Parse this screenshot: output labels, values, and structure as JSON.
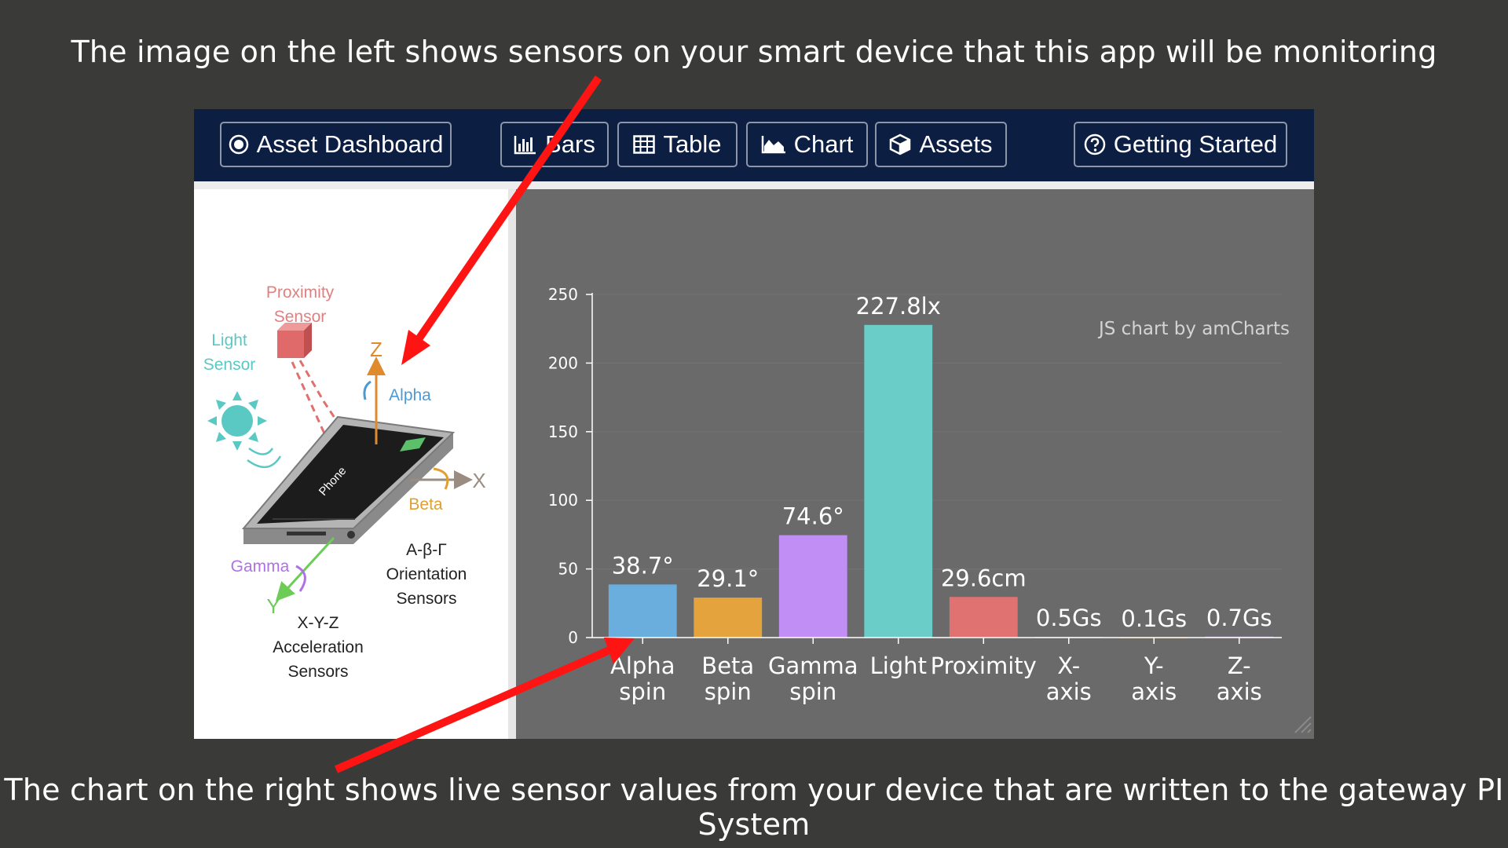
{
  "captions": {
    "top": "The image on the left shows sensors on your smart device that this app will be monitoring",
    "bottom": "The chart on the right shows live sensor values from your device that are written to the gateway PI System"
  },
  "navbar": {
    "dashboard": "Asset Dashboard",
    "bars": "Bars",
    "table": "Table",
    "chart": "Chart",
    "assets": "Assets",
    "getting_started": "Getting Started"
  },
  "diagram": {
    "proximity": [
      "Proximity",
      "Sensor"
    ],
    "light": [
      "Light",
      "Sensor"
    ],
    "z": "Z",
    "alpha": "Alpha",
    "x": "X",
    "beta": "Beta",
    "phone": "Phone",
    "gamma": "Gamma",
    "y": "Y",
    "orientation": [
      "A-β-Γ",
      "Orientation",
      "Sensors"
    ],
    "acceleration": [
      "X-Y-Z",
      "Acceleration",
      "Sensors"
    ]
  },
  "colors": {
    "background": "#3a3a39",
    "navbar": "#0c1e42",
    "plot": "#6a6a6a",
    "arrow": "#ff1414"
  },
  "chart_data": {
    "type": "bar",
    "credit": "JS chart by amCharts",
    "categories": [
      [
        "Alpha",
        "spin"
      ],
      [
        "Beta",
        "spin"
      ],
      [
        "Gamma",
        "spin"
      ],
      [
        "Light"
      ],
      [
        "Proximity"
      ],
      [
        "X-",
        "axis"
      ],
      [
        "Y-",
        "axis"
      ],
      [
        "Z-",
        "axis"
      ]
    ],
    "values": [
      38.7,
      29.1,
      74.6,
      227.8,
      29.6,
      0.5,
      0.1,
      0.7
    ],
    "labels": [
      "38.7°",
      "29.1°",
      "74.6°",
      "227.8lx",
      "29.6cm",
      "0.5Gs",
      "0.1Gs",
      "0.7Gs"
    ],
    "colors": [
      "#6aaede",
      "#e5a33e",
      "#c08ef4",
      "#6acdc7",
      "#e07272",
      "#6aaede",
      "#e5a33e",
      "#c08ef4"
    ],
    "yticks": [
      0,
      50,
      100,
      150,
      200,
      250
    ],
    "ylim": [
      0,
      250
    ],
    "grid": true
  }
}
